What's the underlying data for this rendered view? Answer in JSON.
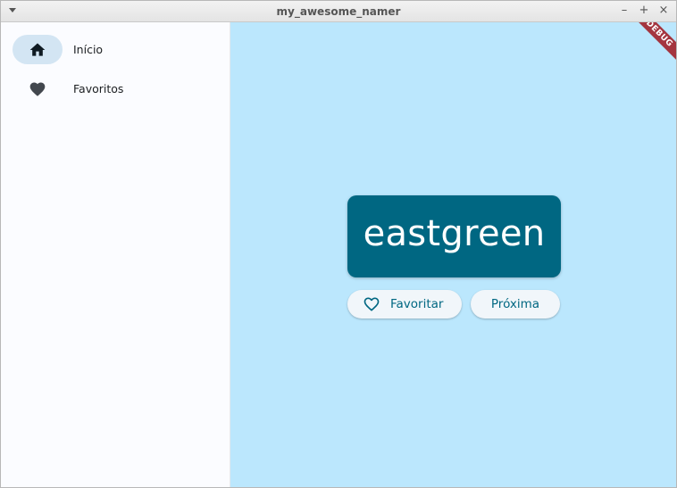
{
  "window": {
    "title": "my_awesome_namer",
    "controls": {
      "minimize": "–",
      "maximize": "+",
      "close": "×"
    }
  },
  "sidebar": {
    "items": [
      {
        "label": "Início",
        "icon": "home-icon",
        "selected": true
      },
      {
        "label": "Favoritos",
        "icon": "heart-icon",
        "selected": false
      }
    ]
  },
  "main": {
    "debug_banner": "DEBUG",
    "word": "eastgreen",
    "like_button": {
      "label": "Favoritar",
      "icon": "heart-outline-icon"
    },
    "next_button": {
      "label": "Próxima"
    }
  },
  "colors": {
    "background": "#bbe7fd",
    "card": "#006782",
    "sidebar": "#fbfcff",
    "nav_indicator": "#d3e5f3",
    "button_text": "#006782",
    "debug_banner": "#a4353f"
  }
}
